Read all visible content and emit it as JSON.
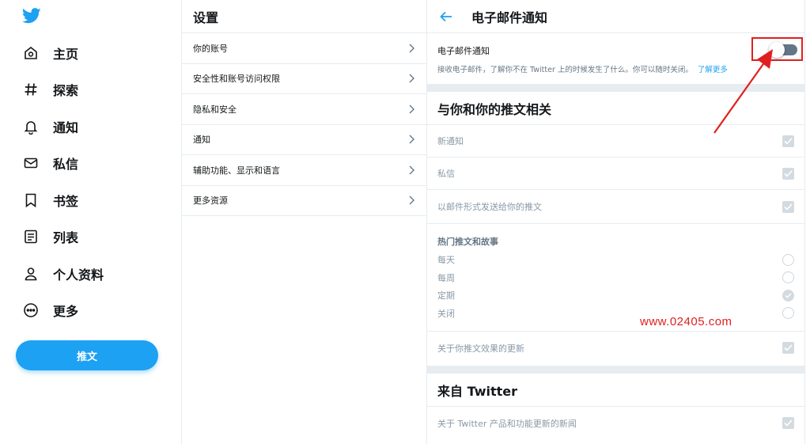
{
  "nav": {
    "items": [
      {
        "label": "主页",
        "icon": "home-icon"
      },
      {
        "label": "探索",
        "icon": "hashtag-icon"
      },
      {
        "label": "通知",
        "icon": "bell-icon"
      },
      {
        "label": "私信",
        "icon": "mail-icon"
      },
      {
        "label": "书签",
        "icon": "bookmark-icon"
      },
      {
        "label": "列表",
        "icon": "list-icon"
      },
      {
        "label": "个人资料",
        "icon": "profile-icon"
      },
      {
        "label": "更多",
        "icon": "more-icon"
      }
    ],
    "tweet_button": "推文"
  },
  "settings": {
    "title": "设置",
    "items": [
      {
        "label": "你的账号"
      },
      {
        "label": "安全性和账号访问权限"
      },
      {
        "label": "隐私和安全"
      },
      {
        "label": "通知"
      },
      {
        "label": "辅助功能、显示和语言"
      },
      {
        "label": "更多资源"
      }
    ]
  },
  "detail": {
    "title": "电子邮件通知",
    "email": {
      "label": "电子邮件通知",
      "description": "接收电子邮件，了解你不在 Twitter 上的时候发生了什么。你可以随时关闭。",
      "link": "了解更多",
      "enabled": false
    },
    "section1": {
      "title": "与你和你的推文相关",
      "checks": [
        {
          "label": "新通知",
          "checked": true
        },
        {
          "label": "私信",
          "checked": true
        },
        {
          "label": "以邮件形式发送给你的推文",
          "checked": true
        }
      ],
      "subgroup": {
        "title": "热门推文和故事",
        "options": [
          {
            "label": "每天",
            "selected": false
          },
          {
            "label": "每周",
            "selected": false
          },
          {
            "label": "定期",
            "selected": true
          },
          {
            "label": "关闭",
            "selected": false
          }
        ]
      },
      "after_check": {
        "label": "关于你推文效果的更新",
        "checked": true
      }
    },
    "section2": {
      "title": "来自 Twitter",
      "check": {
        "label": "关于 Twitter 产品和功能更新的新闻",
        "checked": true
      }
    }
  },
  "watermark": "www.02405.com",
  "colors": {
    "accent": "#1da1f2",
    "annotation": "#e0201f"
  }
}
